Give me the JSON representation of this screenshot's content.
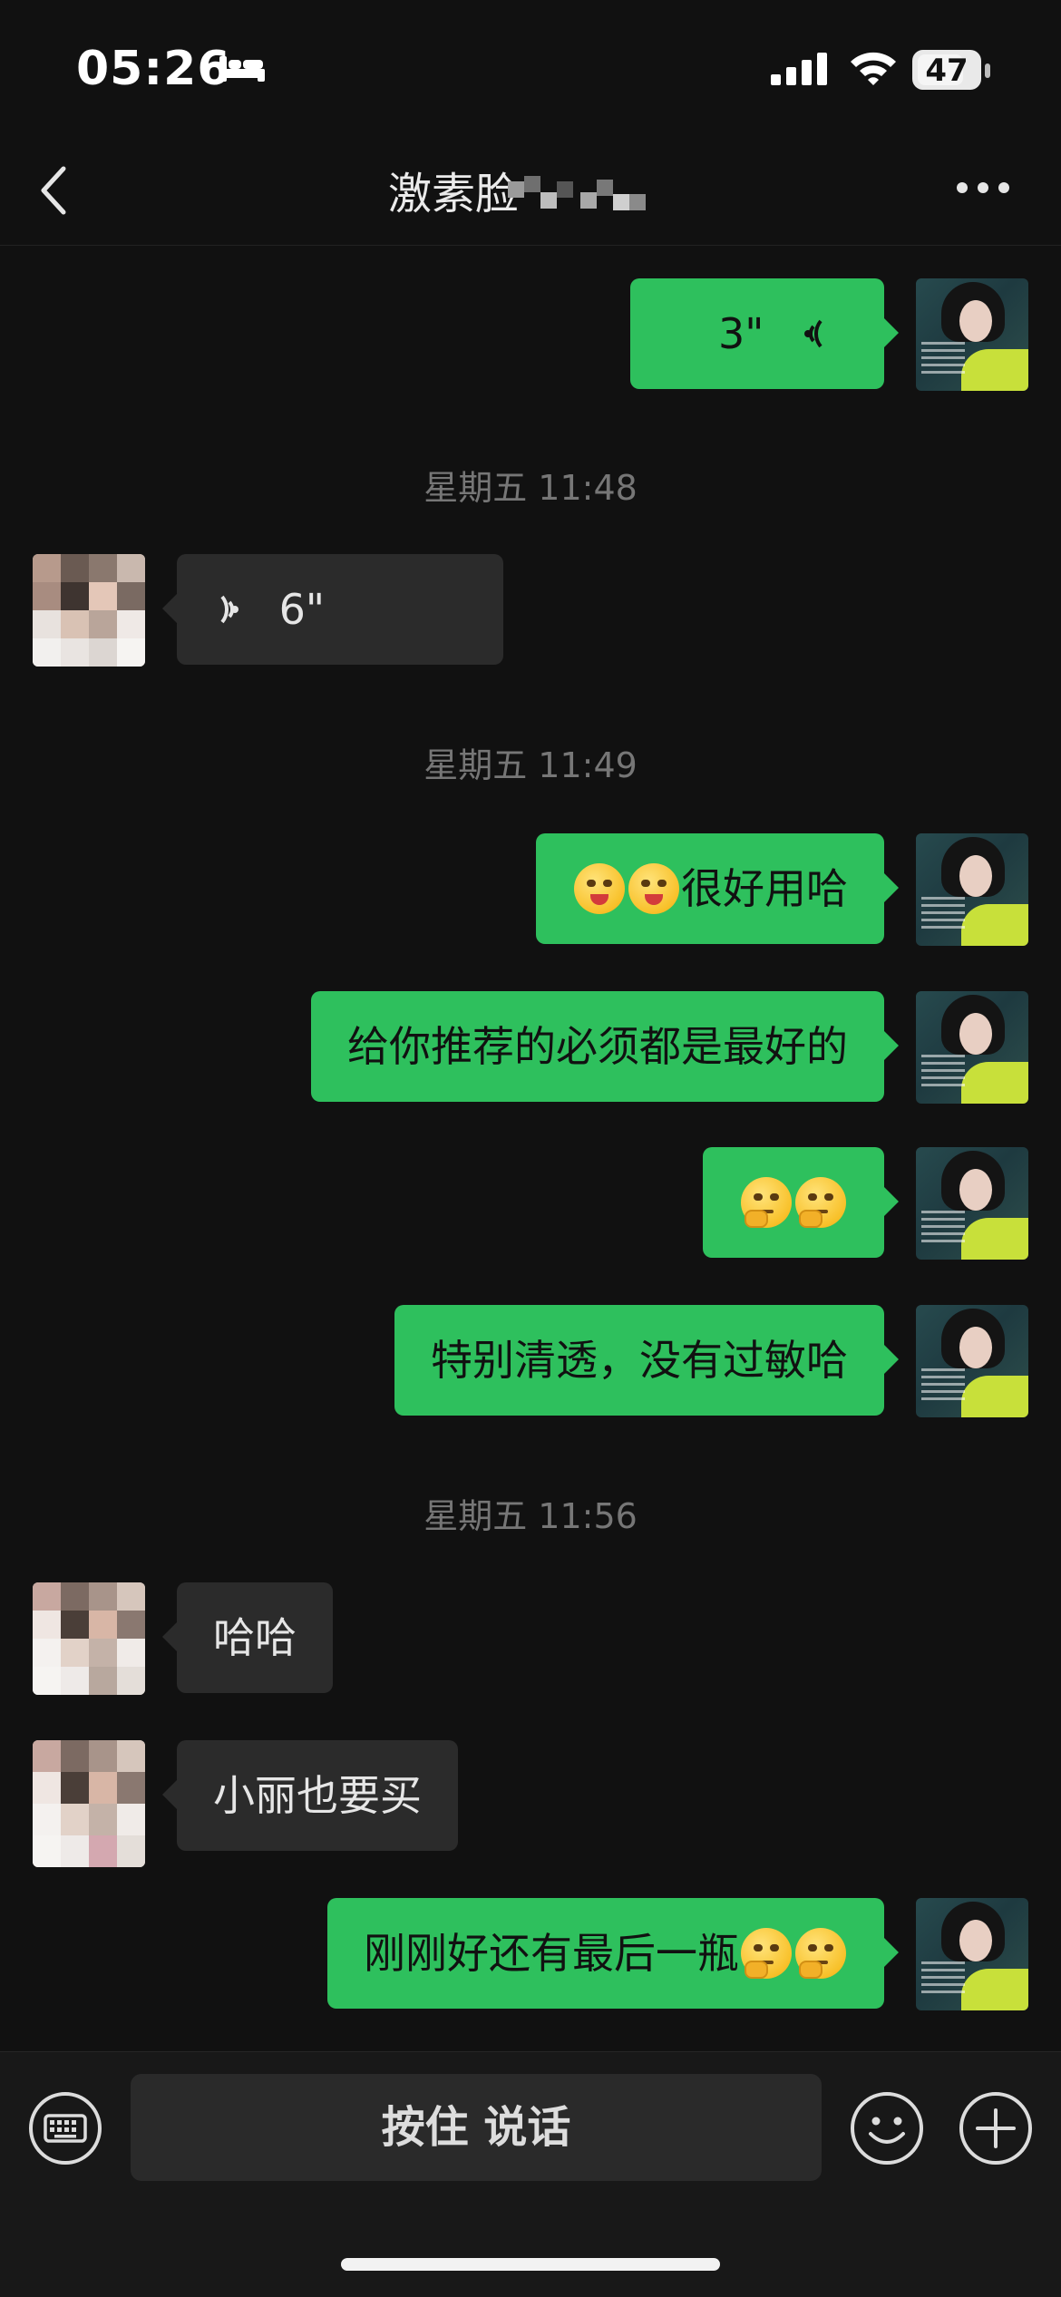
{
  "status_bar": {
    "time": "05:26",
    "battery": "47"
  },
  "nav": {
    "title": "激素脸"
  },
  "messages": {
    "m1_voice": "3\"",
    "ts1": "星期五 11:48",
    "m2_voice": "6\"",
    "ts2": "星期五 11:49",
    "m3_text": "很好用哈",
    "m4_text": "给你推荐的必须都是最好的",
    "ts3": "星期五 11:56",
    "m6_text": "特别清透，没有过敏哈",
    "m7_text": "哈哈",
    "m8_text": "小丽也要买",
    "m9_text": "刚刚好还有最后一瓶"
  },
  "input_bar": {
    "hold_to_talk": "按住 说话"
  },
  "colors": {
    "outgoing_bubble": "#2ec05d",
    "incoming_bubble": "#2b2b2b",
    "background": "#111111"
  }
}
